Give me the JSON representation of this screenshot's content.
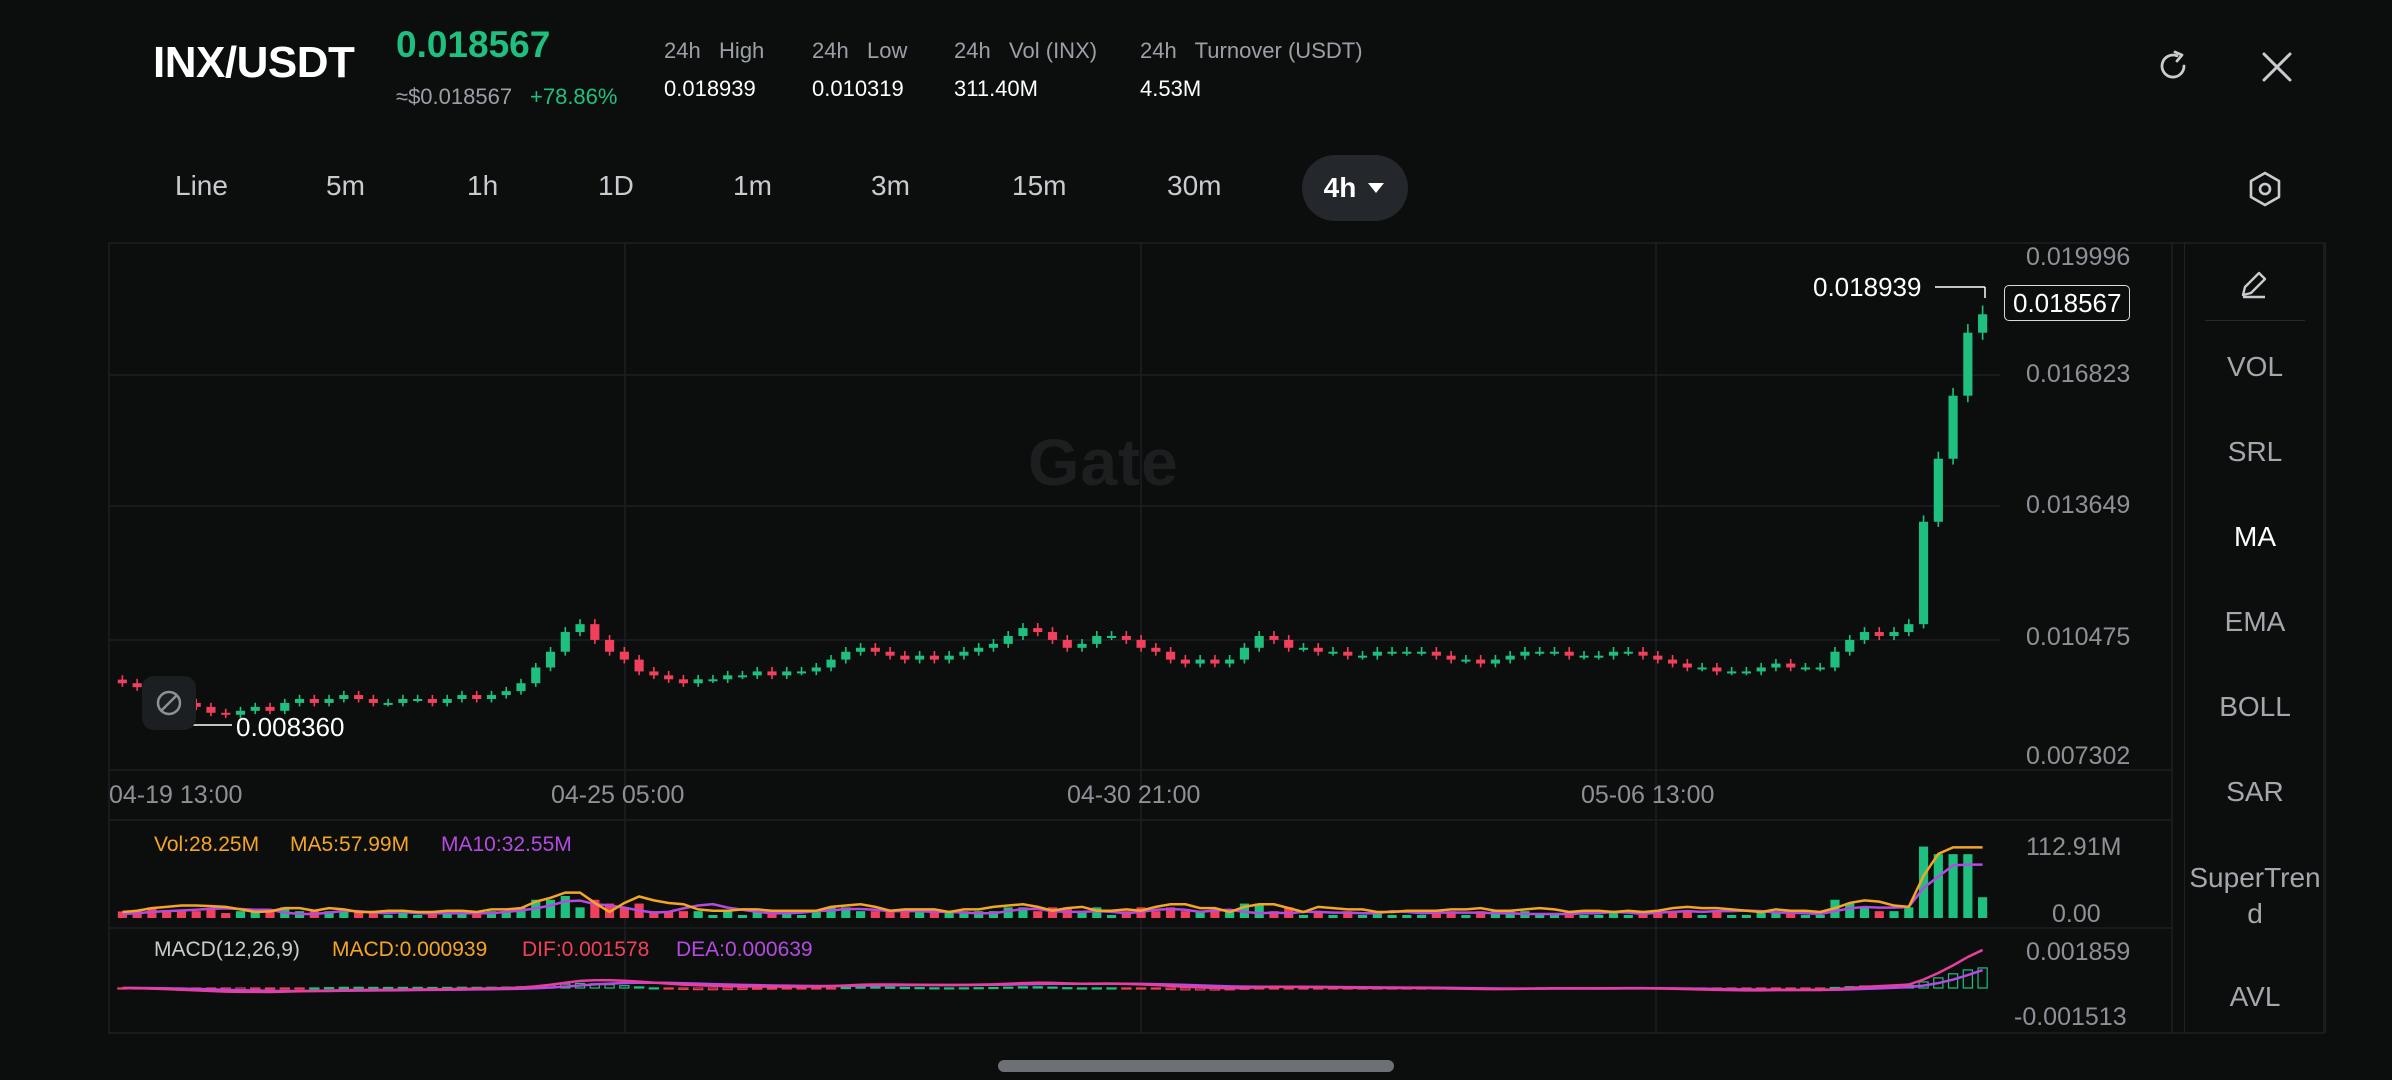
{
  "header": {
    "pair": "INX/USDT",
    "price": "0.018567",
    "usd_price": "≈$0.018567",
    "change": "+78.86%",
    "stats": [
      {
        "label": "24h   High",
        "value": "0.018939"
      },
      {
        "label": "24h   Low",
        "value": "0.010319"
      },
      {
        "label": "24h   Vol (INX)",
        "value": "311.40M"
      },
      {
        "label": "24h   Turnover (USDT)",
        "value": "4.53M"
      }
    ]
  },
  "icons": {
    "refresh": "refresh-icon",
    "close": "close-icon",
    "settings": "settings-hexagon-icon",
    "edit": "pencil-icon",
    "dropdown": "caret-down-icon"
  },
  "timeframes": [
    "Line",
    "5m",
    "1h",
    "1D",
    "1m",
    "3m",
    "15m",
    "30m"
  ],
  "active_timeframe": "4h",
  "watermark": "Gate",
  "price_axis": [
    "0.019996",
    "0.016823",
    "0.013649",
    "0.010475",
    "0.007302"
  ],
  "time_axis": [
    "04-19 13:00",
    "04-25 05:00",
    "04-30 21:00",
    "05-06 13:00"
  ],
  "labels": {
    "high_marker": "0.018939",
    "current_price": "0.018567",
    "low_marker": "0.008360"
  },
  "volume": {
    "vol": "Vol:28.25M",
    "ma5": "MA5:57.99M",
    "ma10": "MA10:32.55M",
    "axis_max": "112.91M",
    "axis_min": "0.00"
  },
  "macd": {
    "title": "MACD(12,26,9)",
    "macd": "MACD:0.000939",
    "dif": "DIF:0.001578",
    "dea": "DEA:0.000639",
    "axis_max": "0.001859",
    "axis_min": "-0.001513"
  },
  "indicators": [
    "VOL",
    "SRL",
    "MA",
    "EMA",
    "BOLL",
    "SAR",
    "SuperTrend",
    "AVL"
  ],
  "colors": {
    "up": "#1fc07f",
    "down": "#f0405b",
    "ma5": "#f5a524",
    "ma10": "#b44be0",
    "dif": "#e63fa0",
    "background": "#0c0e0e"
  },
  "chart_data": {
    "type": "candlestick",
    "ylim": [
      0.007302,
      0.019996
    ],
    "high": 0.018939,
    "low": 0.00836,
    "last": 0.018567,
    "candles_close": [
      0.0092,
      0.0091,
      0.0089,
      0.0088,
      0.0087,
      0.0086,
      0.00845,
      0.0084,
      0.0085,
      0.0086,
      0.0085,
      0.0087,
      0.0088,
      0.0087,
      0.0088,
      0.0089,
      0.0088,
      0.0087,
      0.0087,
      0.0088,
      0.0088,
      0.0087,
      0.0088,
      0.0089,
      0.0088,
      0.0089,
      0.009,
      0.0092,
      0.0096,
      0.01,
      0.0105,
      0.0107,
      0.0103,
      0.01,
      0.0098,
      0.0095,
      0.0094,
      0.0093,
      0.0092,
      0.0093,
      0.0093,
      0.0094,
      0.0094,
      0.0095,
      0.0094,
      0.0095,
      0.0095,
      0.0096,
      0.0098,
      0.01,
      0.0101,
      0.01,
      0.0099,
      0.0098,
      0.0099,
      0.0098,
      0.0099,
      0.01,
      0.0101,
      0.0102,
      0.0104,
      0.0106,
      0.0105,
      0.0103,
      0.0101,
      0.0102,
      0.0104,
      0.0104,
      0.0103,
      0.0101,
      0.01,
      0.0098,
      0.0097,
      0.0098,
      0.0097,
      0.0098,
      0.0101,
      0.0104,
      0.0103,
      0.0101,
      0.0101,
      0.01,
      0.01,
      0.0099,
      0.0099,
      0.01,
      0.01,
      0.01,
      0.01,
      0.0099,
      0.0098,
      0.0098,
      0.0097,
      0.0098,
      0.0099,
      0.01,
      0.01,
      0.01,
      0.0099,
      0.0099,
      0.0099,
      0.01,
      0.01,
      0.0099,
      0.0098,
      0.0097,
      0.0096,
      0.0096,
      0.0095,
      0.0095,
      0.0095,
      0.0096,
      0.0097,
      0.0096,
      0.0096,
      0.0096,
      0.01,
      0.0103,
      0.0105,
      0.0104,
      0.0105,
      0.0107,
      0.0133,
      0.0149,
      0.0165,
      0.0181,
      0.018567
    ],
    "volume_axis": [
      0,
      112.91
    ],
    "macd_axis": [
      -0.001513,
      0.001859
    ]
  }
}
